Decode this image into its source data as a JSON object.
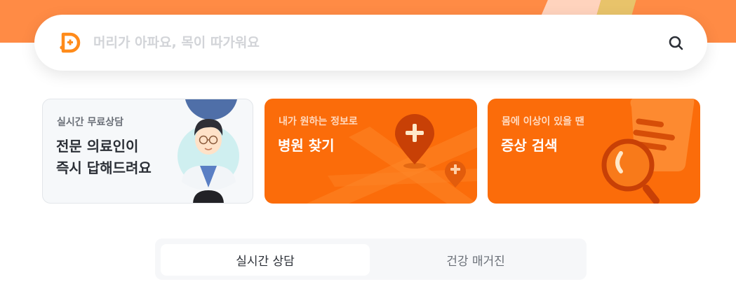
{
  "search": {
    "placeholder": "머리가 아파요, 목이 따가워요"
  },
  "cards": {
    "consult": {
      "subtitle": "실시간 무료상담",
      "title_line1": "전문 의료인이",
      "title_line2": "즉시 답해드려요"
    },
    "hospital": {
      "subtitle": "내가 원하는 정보로",
      "title": "병원 찾기"
    },
    "symptom": {
      "subtitle": "몸에 이상이 있을 땐",
      "title": "증상 검색"
    }
  },
  "tabs": [
    {
      "label": "실시간 상담",
      "active": true
    },
    {
      "label": "건강 매거진",
      "active": false
    }
  ],
  "colors": {
    "brand_orange": "#fb6c0a",
    "banner_orange": "#ff8b45",
    "card_light": "#f6f8fa"
  },
  "icons": {
    "logo": "doctor-app-logo-icon",
    "search": "search-icon",
    "location_pin": "map-pin-plus-icon",
    "magnifier": "magnifier-icon"
  }
}
